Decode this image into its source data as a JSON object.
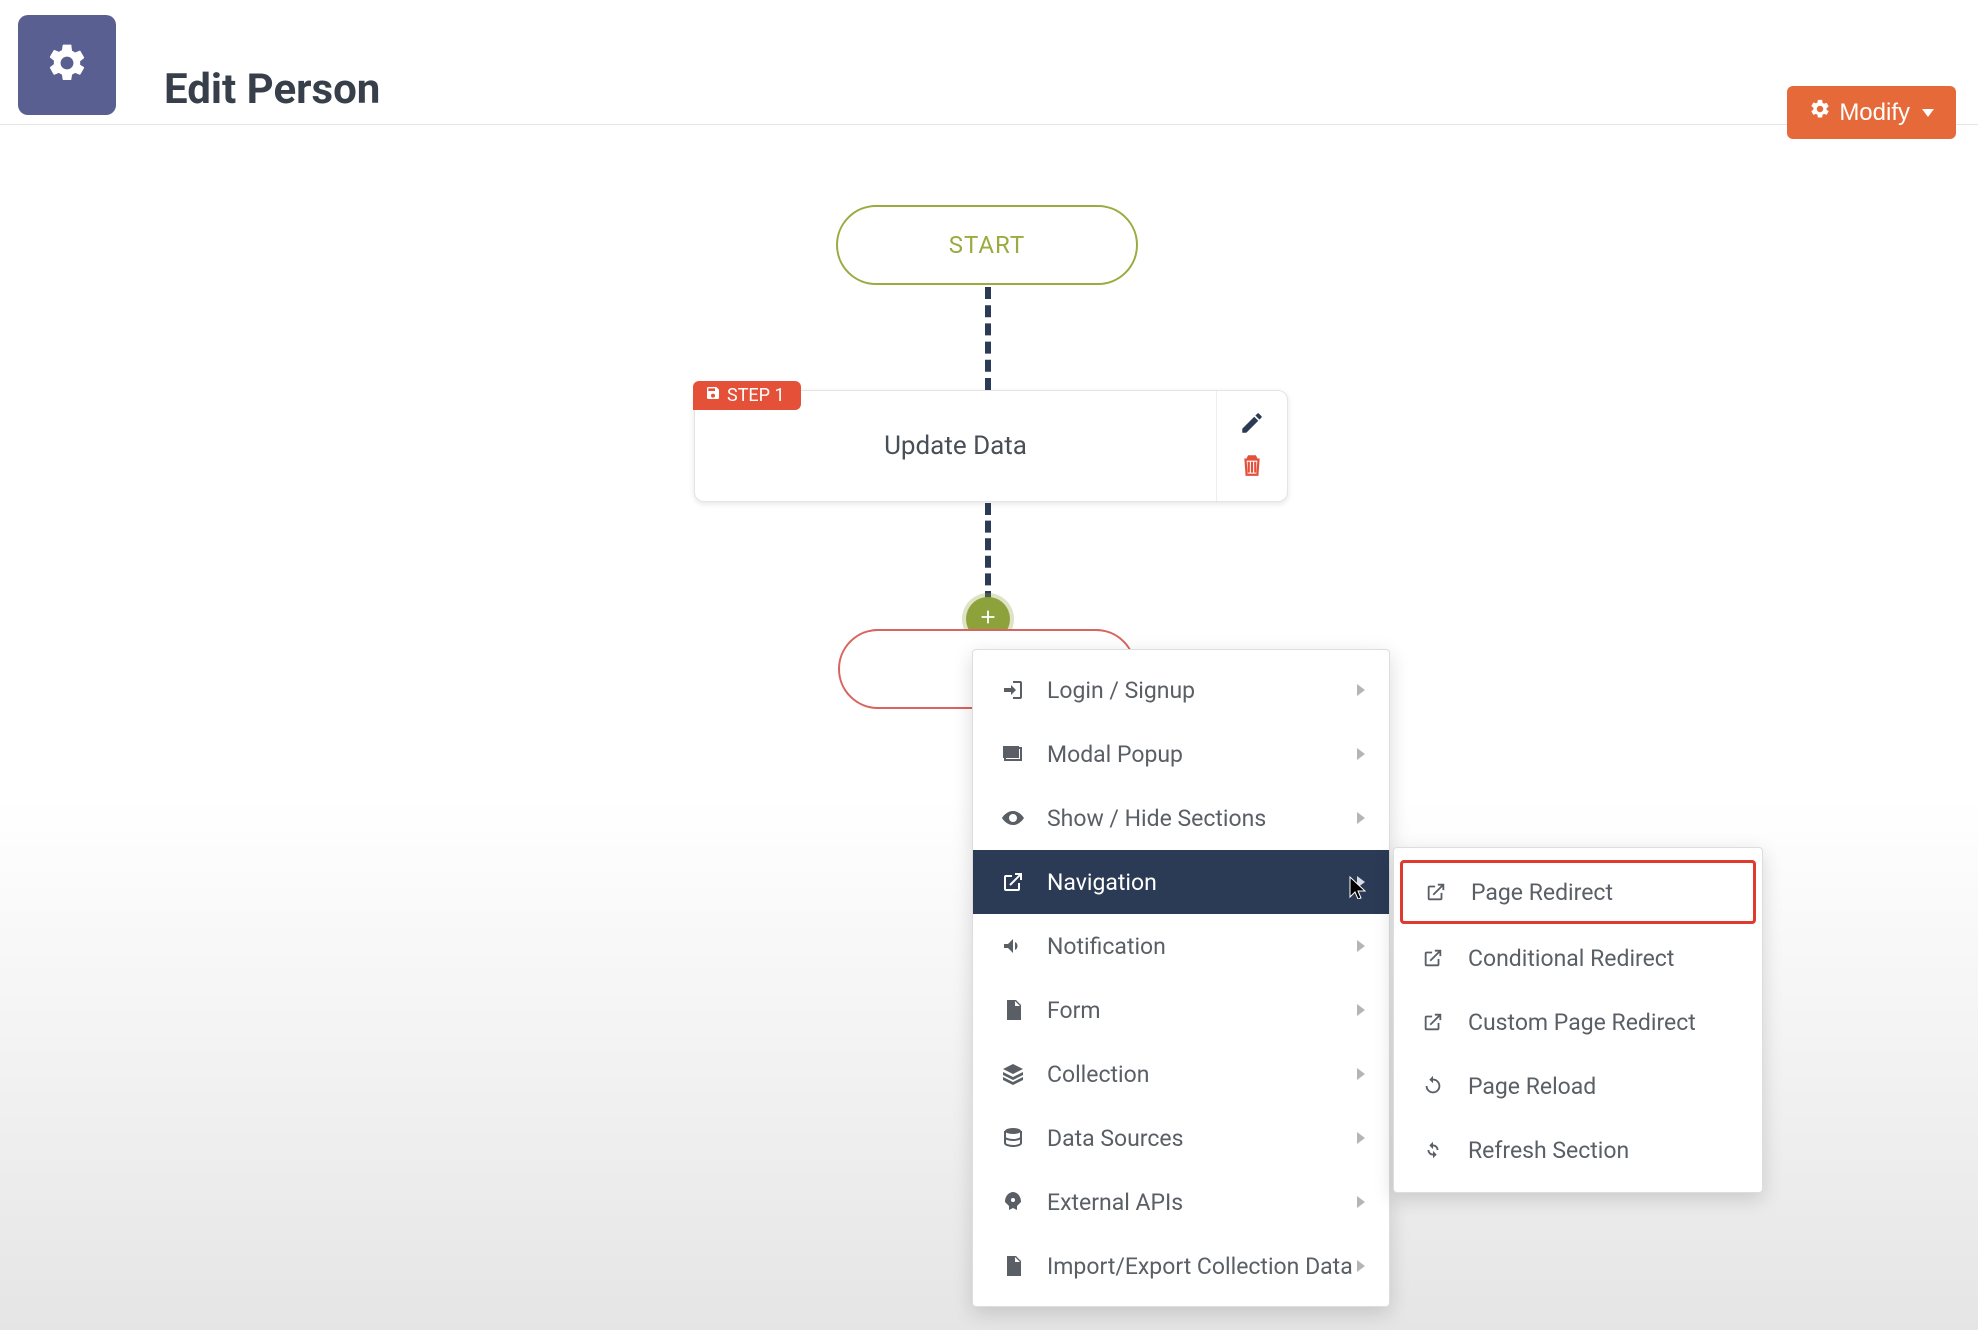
{
  "header": {
    "title": "Edit Person",
    "modify_label": "Modify"
  },
  "flow": {
    "start_label": "START",
    "step_badge": "STEP 1",
    "step_label": "Update Data"
  },
  "menu": {
    "items": [
      {
        "icon": "login-icon",
        "label": "Login / Signup",
        "has_sub": true
      },
      {
        "icon": "modal-icon",
        "label": "Modal Popup",
        "has_sub": true
      },
      {
        "icon": "eye-icon",
        "label": "Show / Hide Sections",
        "has_sub": true
      },
      {
        "icon": "external-icon",
        "label": "Navigation",
        "has_sub": true,
        "active": true
      },
      {
        "icon": "megaphone-icon",
        "label": "Notification",
        "has_sub": true
      },
      {
        "icon": "file-icon",
        "label": "Form",
        "has_sub": true
      },
      {
        "icon": "layers-icon",
        "label": "Collection",
        "has_sub": true
      },
      {
        "icon": "database-icon",
        "label": "Data Sources",
        "has_sub": true
      },
      {
        "icon": "rocket-icon",
        "label": "External APIs",
        "has_sub": true
      },
      {
        "icon": "file-icon",
        "label": "Import/Export Collection Data",
        "has_sub": true
      }
    ]
  },
  "submenu": {
    "items": [
      {
        "icon": "external-icon",
        "label": "Page Redirect",
        "highlighted": true
      },
      {
        "icon": "external-icon",
        "label": "Conditional Redirect"
      },
      {
        "icon": "external-icon",
        "label": "Custom Page Redirect"
      },
      {
        "icon": "refresh-icon",
        "label": "Page Reload"
      },
      {
        "icon": "sync-icon",
        "label": "Refresh Section"
      }
    ]
  },
  "colors": {
    "accent_orange": "#e66a39",
    "accent_red": "#e55039",
    "accent_green": "#8ea23c",
    "nav_active": "#2b3a55",
    "nav_square": "#5a5f92"
  }
}
